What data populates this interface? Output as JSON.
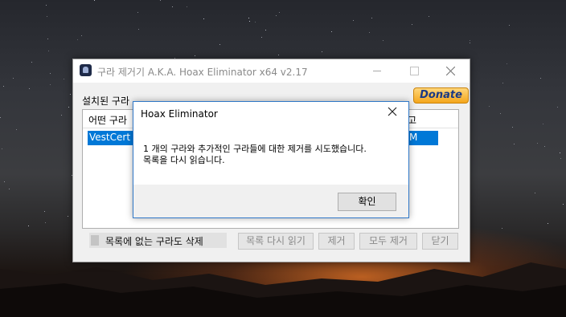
{
  "main_window": {
    "title": "구라 제거기 A.K.A. Hoax Eliminator x64 v2.17",
    "installed_label": "설치된 구라",
    "donate_label": "Donate",
    "list": {
      "header_col1": "어떤 구라",
      "header_col2": "고",
      "rows": [
        {
          "name": "VestCert",
          "date_fragment": "M",
          "selected": true
        }
      ]
    },
    "checkbox_label": "목록에 없는 구라도 삭제",
    "buttons": {
      "reload": "목록 다시 읽기",
      "remove": "제거",
      "remove_all": "모두 제거",
      "close": "닫기"
    }
  },
  "dialog": {
    "title": "Hoax Eliminator",
    "message_line1": "1 개의 구라와 추가적인 구라들에 대한 제거를 시도했습니다.",
    "message_line2": "목록을 다시 읽습니다.",
    "ok_label": "확인"
  },
  "colors": {
    "selection": "#0078d7",
    "dialog_border": "#3078c8",
    "donate_gold": "#f4a61c",
    "donate_text": "#1a3a85"
  }
}
